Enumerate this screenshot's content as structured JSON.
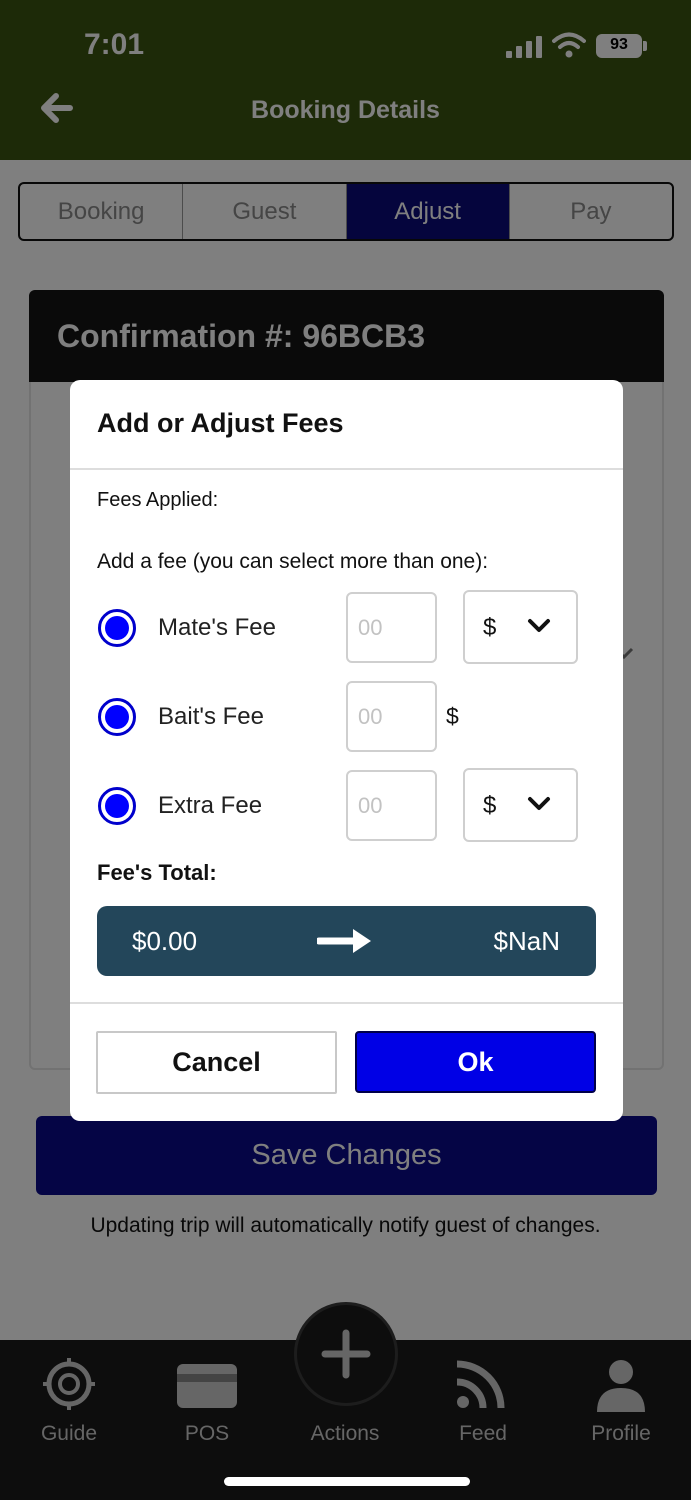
{
  "status_bar": {
    "time": "7:01",
    "battery": "93"
  },
  "header": {
    "title": "Booking Details",
    "back_icon": "arrow-left-icon"
  },
  "tabs": [
    {
      "label": "Booking",
      "active": false
    },
    {
      "label": "Guest",
      "active": false
    },
    {
      "label": "Adjust",
      "active": true
    },
    {
      "label": "Pay",
      "active": false
    }
  ],
  "confirmation": {
    "title": "Confirmation #: 96BCB3"
  },
  "modal": {
    "title": "Add or Adjust Fees",
    "fees_applied_label": "Fees Applied:",
    "add_fee_label": "Add a fee (you can select more than one):",
    "fees": [
      {
        "name": "Mate's Fee",
        "placeholder": "00",
        "currency": "$",
        "has_dropdown": true,
        "selected": true
      },
      {
        "name": "Bait's Fee",
        "placeholder": "00",
        "currency": "$",
        "has_dropdown": false,
        "selected": true
      },
      {
        "name": "Extra Fee",
        "placeholder": "00",
        "currency": "$",
        "has_dropdown": true,
        "selected": true
      }
    ],
    "total_label": "Fee's Total:",
    "total_old": "$0.00",
    "total_new": "$NaN",
    "cancel_label": "Cancel",
    "ok_label": "Ok"
  },
  "save_changes_label": "Save Changes",
  "notify_text": "Updating trip will automatically notify guest of changes.",
  "bottom_nav": [
    {
      "label": "Guide",
      "icon": "compass-logo-icon"
    },
    {
      "label": "POS",
      "icon": "credit-card-icon"
    },
    {
      "label": "Actions",
      "icon": "plus-icon"
    },
    {
      "label": "Feed",
      "icon": "rss-feed-icon"
    },
    {
      "label": "Profile",
      "icon": "person-icon"
    }
  ],
  "colors": {
    "header_bg": "#3a5411",
    "active_tab": "#0b0b7a",
    "radio": "#0000ff",
    "ok_button": "#0000e6",
    "total_bar": "#23465a"
  }
}
